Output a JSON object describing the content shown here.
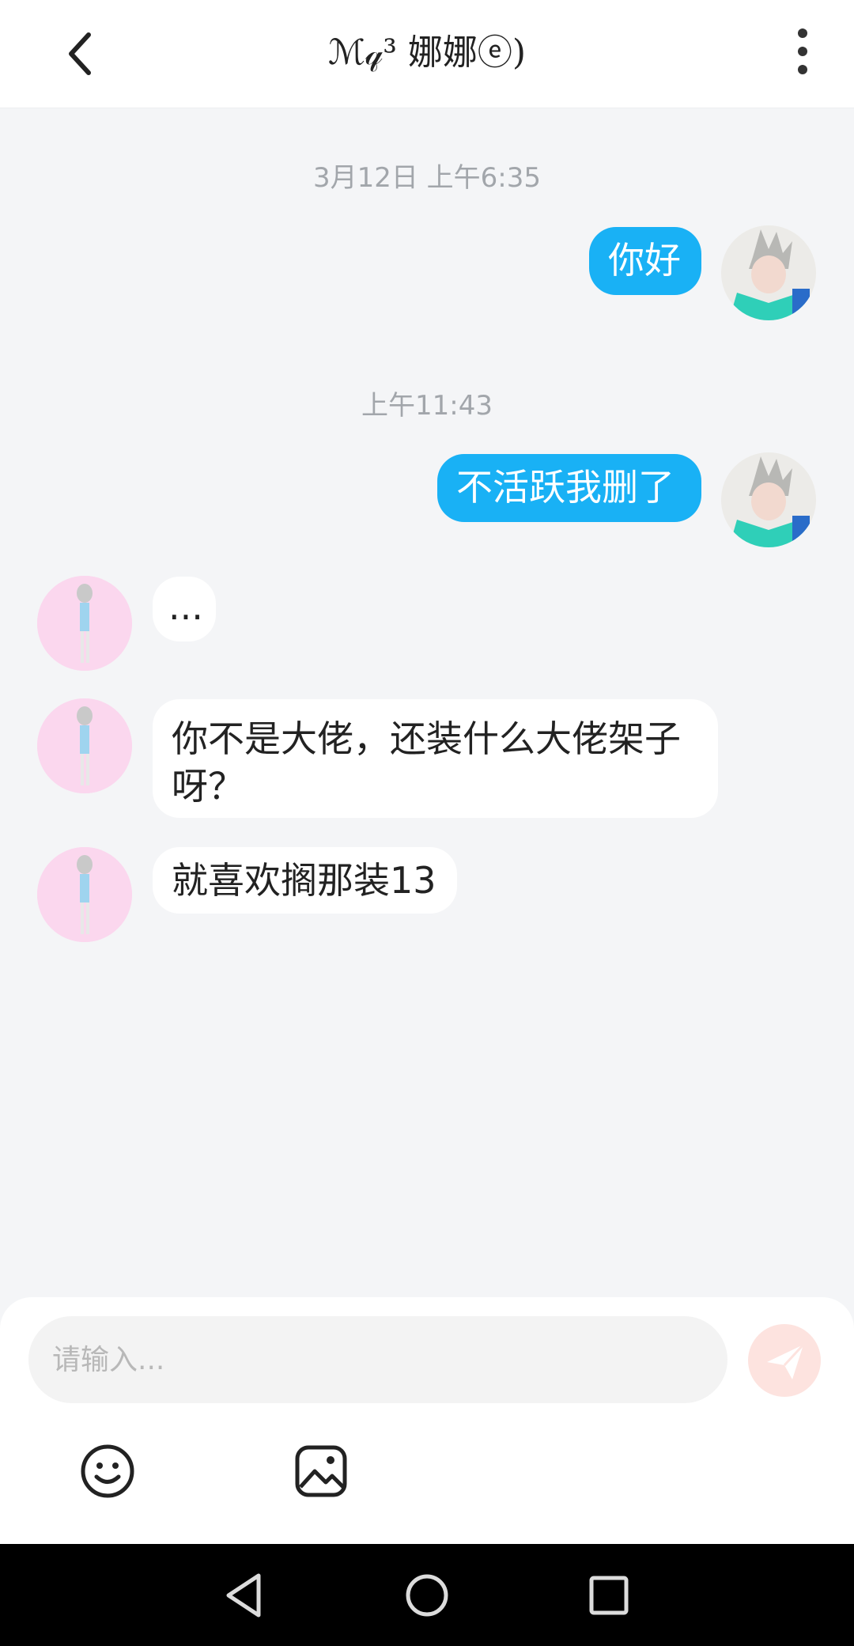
{
  "header": {
    "title": "ℳ𝓆³ 娜娜ⓔ)",
    "back_icon": "chevron-left-icon",
    "more_icon": "more-vertical-icon"
  },
  "chat": {
    "timestamps": [
      "3月12日 上午6:35",
      "上午11:43"
    ],
    "messages": [
      {
        "from": "me",
        "text": "你好"
      },
      {
        "from": "me",
        "text": "不活跃我删了"
      },
      {
        "from": "her",
        "text": "..."
      },
      {
        "from": "her",
        "text": "你不是大佬，还装什么大佬架子呀？"
      },
      {
        "from": "her",
        "text": "就喜欢搁那装13"
      }
    ]
  },
  "composer": {
    "placeholder": "请输入...",
    "send_icon": "send-icon",
    "emoji_icon": "emoji-icon",
    "image_icon": "image-icon"
  },
  "navbar": {
    "back": "triangle-back-icon",
    "home": "circle-home-icon",
    "recents": "square-recents-icon"
  },
  "colors": {
    "my_bubble": "#19b1f5",
    "other_bubble": "#ffffff",
    "background": "#f4f5f7",
    "send_button": "#fde3df"
  }
}
